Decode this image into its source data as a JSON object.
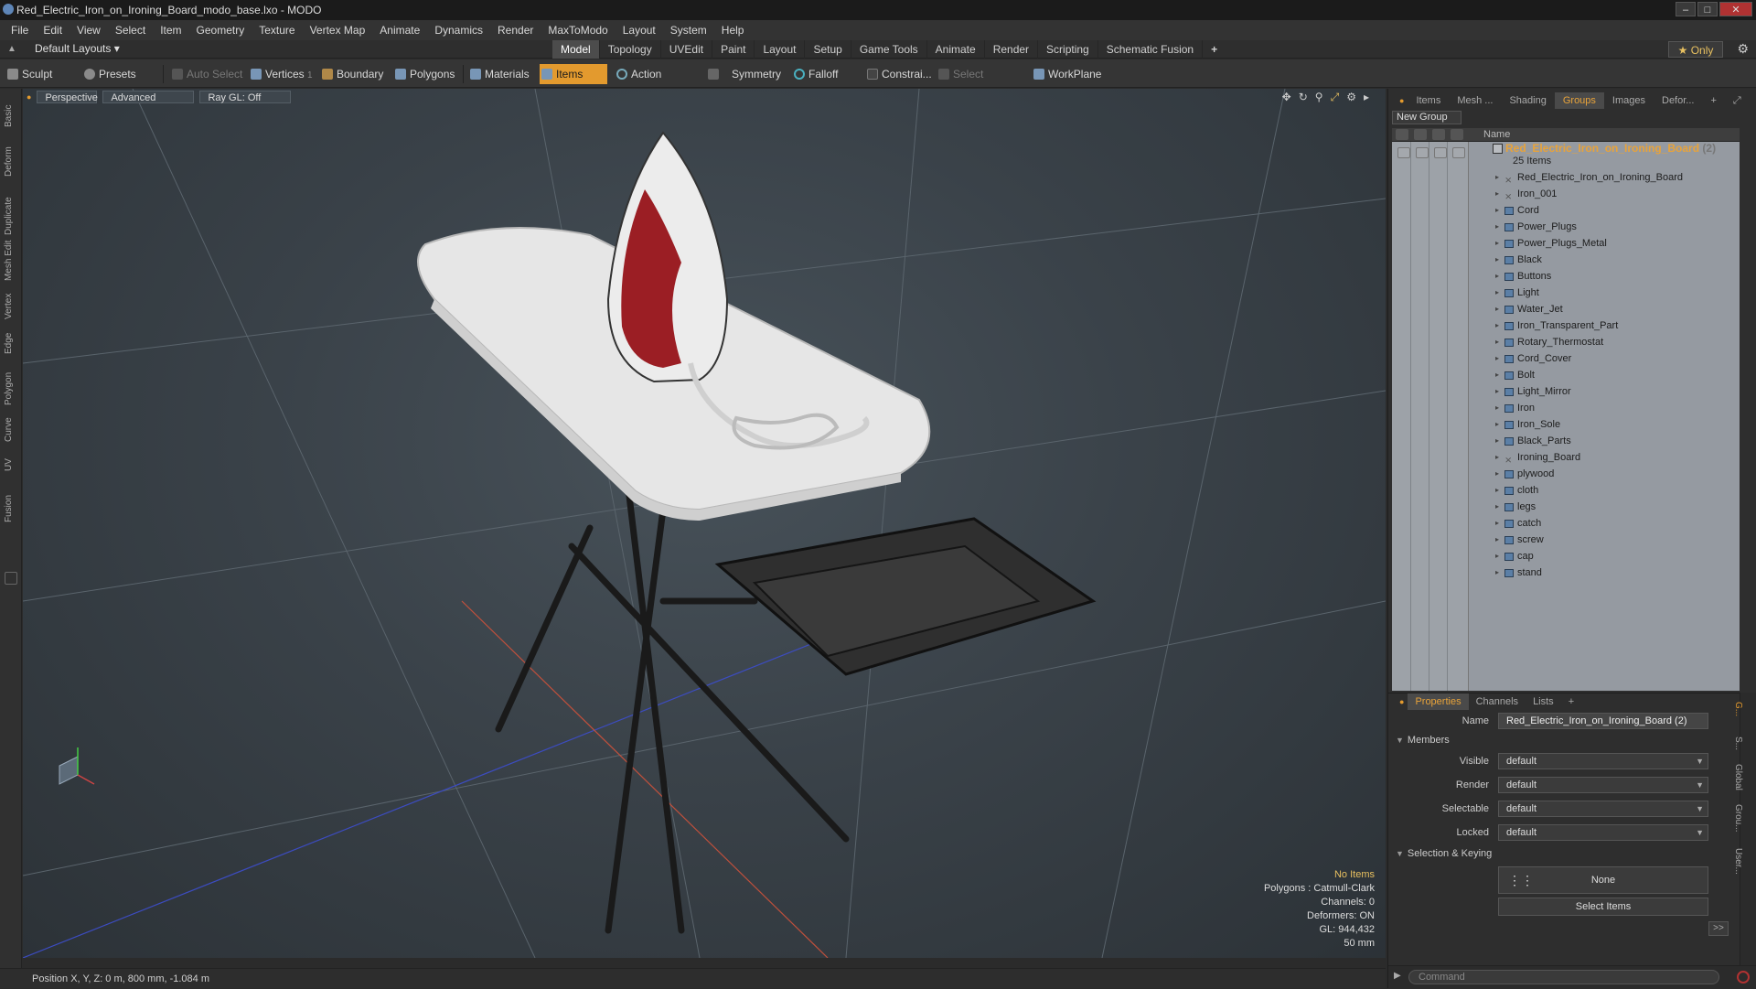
{
  "window": {
    "title": "Red_Electric_Iron_on_Ironing_Board_modo_base.lxo - MODO"
  },
  "menu": [
    "File",
    "Edit",
    "View",
    "Select",
    "Item",
    "Geometry",
    "Texture",
    "Vertex Map",
    "Animate",
    "Dynamics",
    "Render",
    "MaxToModo",
    "Layout",
    "System",
    "Help"
  ],
  "layout": {
    "default_layouts": "Default Layouts",
    "tabs": [
      "Model",
      "Topology",
      "UVEdit",
      "Paint",
      "Layout",
      "Setup",
      "Game Tools",
      "Animate",
      "Render",
      "Scripting",
      "Schematic Fusion"
    ],
    "active_tab": "Model",
    "add_tab": "+",
    "only_label": "★ Only"
  },
  "toolbar": {
    "sculpt": "Sculpt",
    "presets": "Presets",
    "auto_select": "Auto Select",
    "vertices": "Vertices",
    "vertices_count": "1",
    "boundary": "Boundary",
    "polygons": "Polygons",
    "materials": "Materials",
    "items": "Items",
    "action_center": "Action Center",
    "symmetry": "Symmetry",
    "falloff": "Falloff",
    "constraints": "Constrai...",
    "select_through": "Select Through",
    "workplane": "WorkPlane"
  },
  "left_tabs": [
    "Basic",
    "Deform",
    "Duplicate",
    "Mesh Edit",
    "Vertex",
    "Edge",
    "Polygon",
    "Curve",
    "UV",
    "Fusion"
  ],
  "viewport": {
    "perspective": "Perspective",
    "advanced": "Advanced",
    "raygl": "Ray GL: Off",
    "info": {
      "selection": "No Items",
      "polygons": "Polygons : Catmull-Clark",
      "channels": "Channels: 0",
      "deformers": "Deformers: ON",
      "gl": "GL: 944,432",
      "scale": "50 mm"
    }
  },
  "status": {
    "position": "Position X, Y, Z:  0 m, 800 mm, -1.084 m"
  },
  "right_panel": {
    "tabs": [
      "Items",
      "Mesh ...",
      "Shading",
      "Groups",
      "Images",
      "Defor..."
    ],
    "active_tab": "Groups",
    "new_group": "New Group",
    "name_header": "Name",
    "group": {
      "name": "Red_Electric_Iron_on_Ironing_Board",
      "suffix": "(2)",
      "count": "25 Items"
    },
    "items": [
      {
        "name": "Red_Electric_Iron_on_Ironing_Board",
        "type": "locator"
      },
      {
        "name": "Iron_001",
        "type": "locator"
      },
      {
        "name": "Cord",
        "type": "mesh"
      },
      {
        "name": "Power_Plugs",
        "type": "mesh"
      },
      {
        "name": "Power_Plugs_Metal",
        "type": "mesh"
      },
      {
        "name": "Black",
        "type": "mesh"
      },
      {
        "name": "Buttons",
        "type": "mesh"
      },
      {
        "name": "Light",
        "type": "mesh"
      },
      {
        "name": "Water_Jet",
        "type": "mesh"
      },
      {
        "name": "Iron_Transparent_Part",
        "type": "mesh"
      },
      {
        "name": "Rotary_Thermostat",
        "type": "mesh"
      },
      {
        "name": "Cord_Cover",
        "type": "mesh"
      },
      {
        "name": "Bolt",
        "type": "mesh"
      },
      {
        "name": "Light_Mirror",
        "type": "mesh"
      },
      {
        "name": "Iron",
        "type": "mesh"
      },
      {
        "name": "Iron_Sole",
        "type": "mesh"
      },
      {
        "name": "Black_Parts",
        "type": "mesh"
      },
      {
        "name": "Ironing_Board",
        "type": "locator"
      },
      {
        "name": "plywood",
        "type": "mesh"
      },
      {
        "name": "cloth",
        "type": "mesh"
      },
      {
        "name": "legs",
        "type": "mesh"
      },
      {
        "name": "catch",
        "type": "mesh"
      },
      {
        "name": "screw",
        "type": "mesh"
      },
      {
        "name": "cap",
        "type": "mesh"
      },
      {
        "name": "stand",
        "type": "mesh"
      }
    ]
  },
  "properties": {
    "tabs": [
      "Properties",
      "Channels",
      "Lists",
      "+"
    ],
    "active_tab": "Properties",
    "name_label": "Name",
    "name_value": "Red_Electric_Iron_on_Ironing_Board (2)",
    "members_label": "Members",
    "visible_label": "Visible",
    "visible_value": "default",
    "render_label": "Render",
    "render_value": "default",
    "selectable_label": "Selectable",
    "selectable_value": "default",
    "locked_label": "Locked",
    "locked_value": "default",
    "sel_keying_label": "Selection & Keying",
    "none_button": "None",
    "select_items_button": "Select Items",
    "more": ">>",
    "side_tabs": [
      "G...",
      "S...",
      "Global",
      "Grou...",
      "User..."
    ]
  },
  "command": {
    "placeholder": "Command"
  }
}
